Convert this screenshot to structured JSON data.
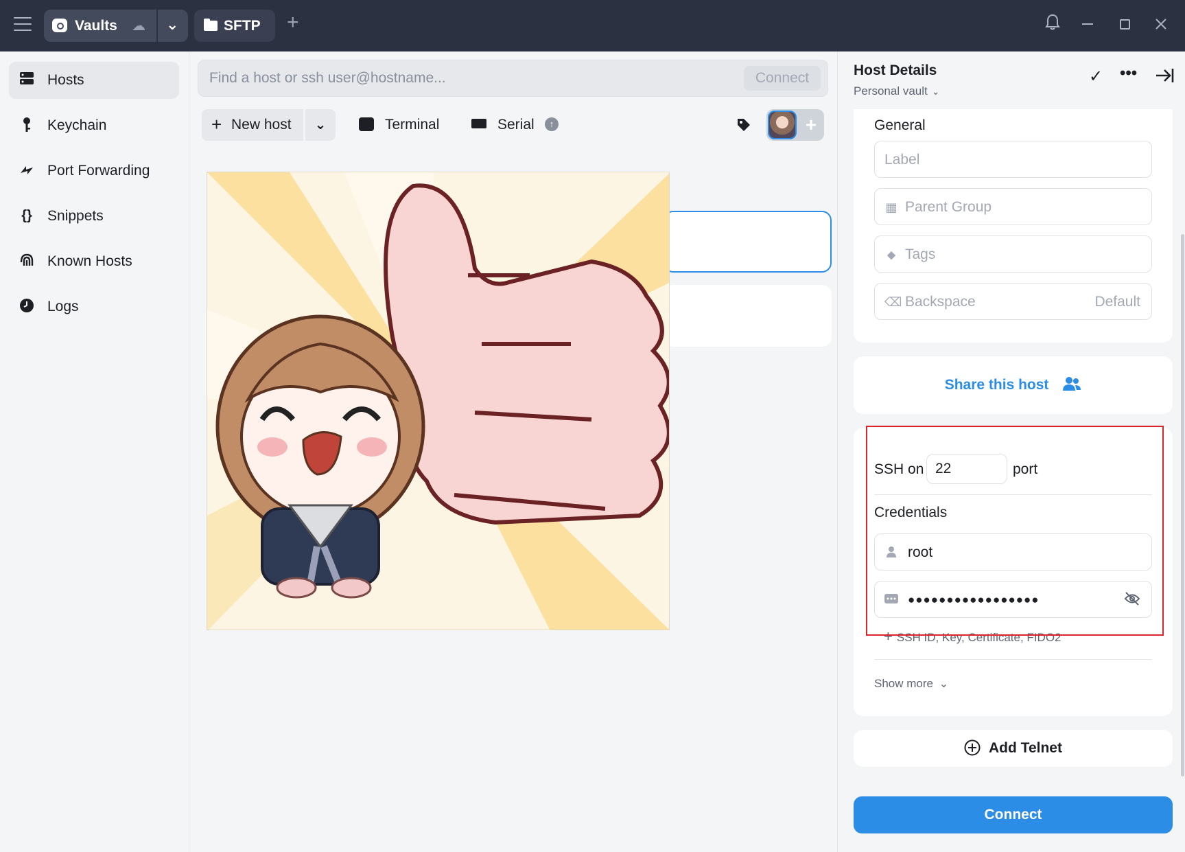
{
  "topbar": {
    "vaults_label": "Vaults",
    "sftp_label": "SFTP"
  },
  "sidebar": {
    "items": [
      {
        "label": "Hosts",
        "icon": "server-icon",
        "active": true
      },
      {
        "label": "Keychain",
        "icon": "key-icon"
      },
      {
        "label": "Port Forwarding",
        "icon": "forward-icon"
      },
      {
        "label": "Snippets",
        "icon": "braces-icon"
      },
      {
        "label": "Known Hosts",
        "icon": "fingerprint-icon"
      },
      {
        "label": "Logs",
        "icon": "clock-icon"
      }
    ]
  },
  "search": {
    "placeholder": "Find a host or ssh user@hostname...",
    "connect_label": "Connect"
  },
  "toolbar": {
    "new_host_label": "New host",
    "terminal_label": "Terminal",
    "serial_label": "Serial"
  },
  "panel": {
    "title": "Host Details",
    "vault": "Personal vault",
    "general_title": "General",
    "label_placeholder": "Label",
    "parent_group_placeholder": "Parent Group",
    "tags_placeholder": "Tags",
    "backspace_label": "Backspace",
    "backspace_value": "Default",
    "share_label": "Share this host",
    "ssh_on": "SSH on",
    "port_value": "22",
    "port_label": "port",
    "credentials_title": "Credentials",
    "username": "root",
    "password_mask": "●●●●●●●●●●●●●●●●●",
    "add_key_label": "SSH ID, Key, Certificate, FIDO2",
    "show_more": "Show more",
    "add_telnet": "Add Telnet",
    "connect_label": "Connect"
  },
  "colors": {
    "accent": "#2b8de6",
    "topbar": "#2c3142",
    "highlight": "#d9252b"
  }
}
